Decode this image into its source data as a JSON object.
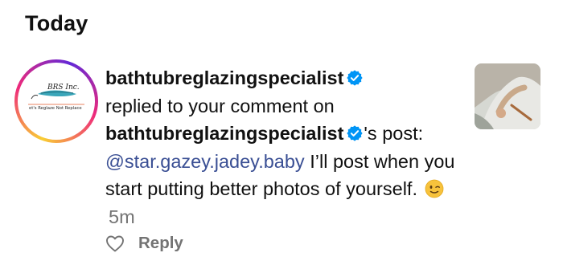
{
  "section": {
    "title": "Today"
  },
  "notification": {
    "avatar": {
      "logo_text": "BRS Inc.",
      "tagline": "et's Reglaze Not Replace"
    },
    "username": "bathtubreglazingspecialist",
    "action_text": "replied to your comment on",
    "post_owner": "bathtubreglazingspecialist",
    "post_suffix": "'s post:",
    "mention": "@star.gazey.jadey.baby",
    "comment_text": " I’ll post when you start putting better photos of yourself.",
    "emoji": "winking-face",
    "timestamp": "5m",
    "verified_color": "#0095f6",
    "mention_color": "#3a4f94"
  },
  "actions": {
    "like_icon": "heart-icon",
    "reply_label": "Reply"
  }
}
